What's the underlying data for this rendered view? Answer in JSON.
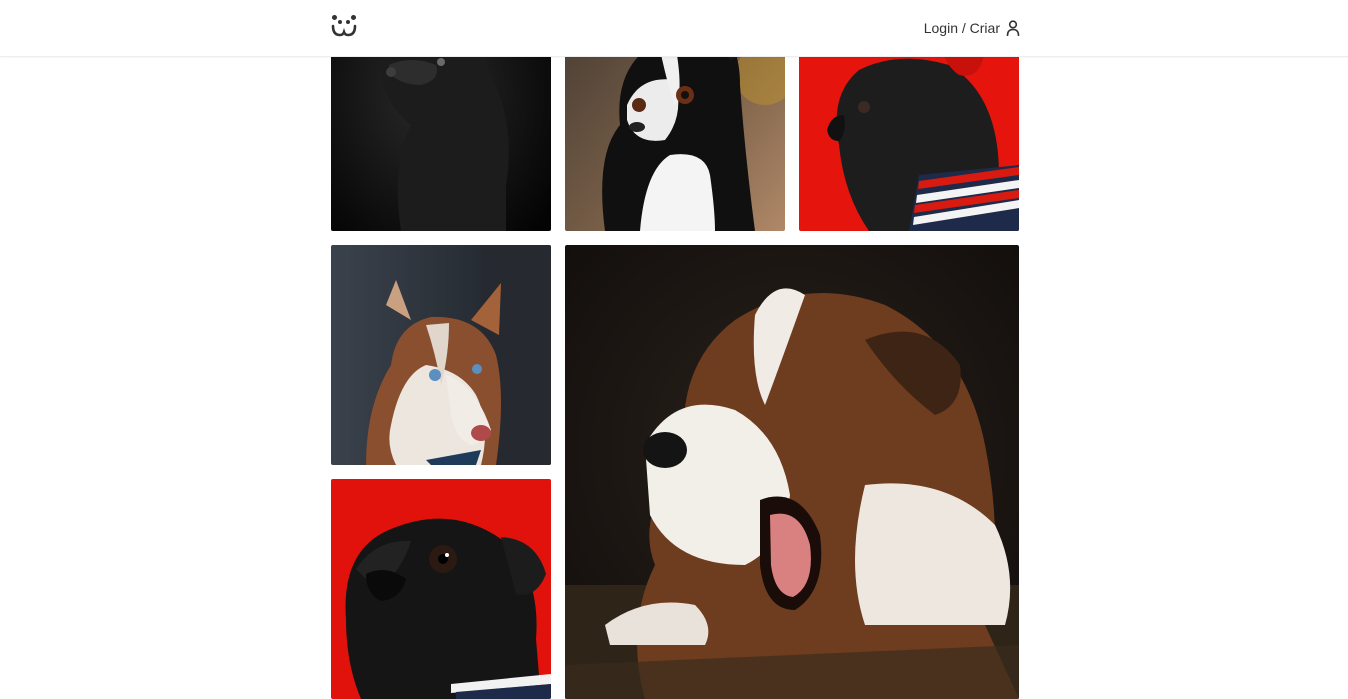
{
  "header": {
    "logo_icon": "dog-face-logo-icon",
    "login_label": "Login / Criar",
    "user_icon": "user-icon"
  },
  "feed": {
    "photos": [
      {
        "subject": "black-dog-looking-up",
        "palette": [
          "#050505",
          "#1a1a1a",
          "#2c2c2c"
        ]
      },
      {
        "subject": "boston-terrier",
        "palette": [
          "#6a5a4a",
          "#111111",
          "#f2f2f2"
        ]
      },
      {
        "subject": "pug-red-beret",
        "palette": [
          "#e3130c",
          "#1b1b1b",
          "#c01010"
        ]
      },
      {
        "subject": "siberian-husky",
        "palette": [
          "#2b3037",
          "#a0643c",
          "#e8e2dc"
        ]
      },
      {
        "subject": "yawning-puppy",
        "palette": [
          "#161210",
          "#6b3a1e",
          "#f1ece6"
        ]
      },
      {
        "subject": "pug-red-background",
        "palette": [
          "#e0120b",
          "#121212",
          "#2a2a2a"
        ]
      }
    ]
  }
}
